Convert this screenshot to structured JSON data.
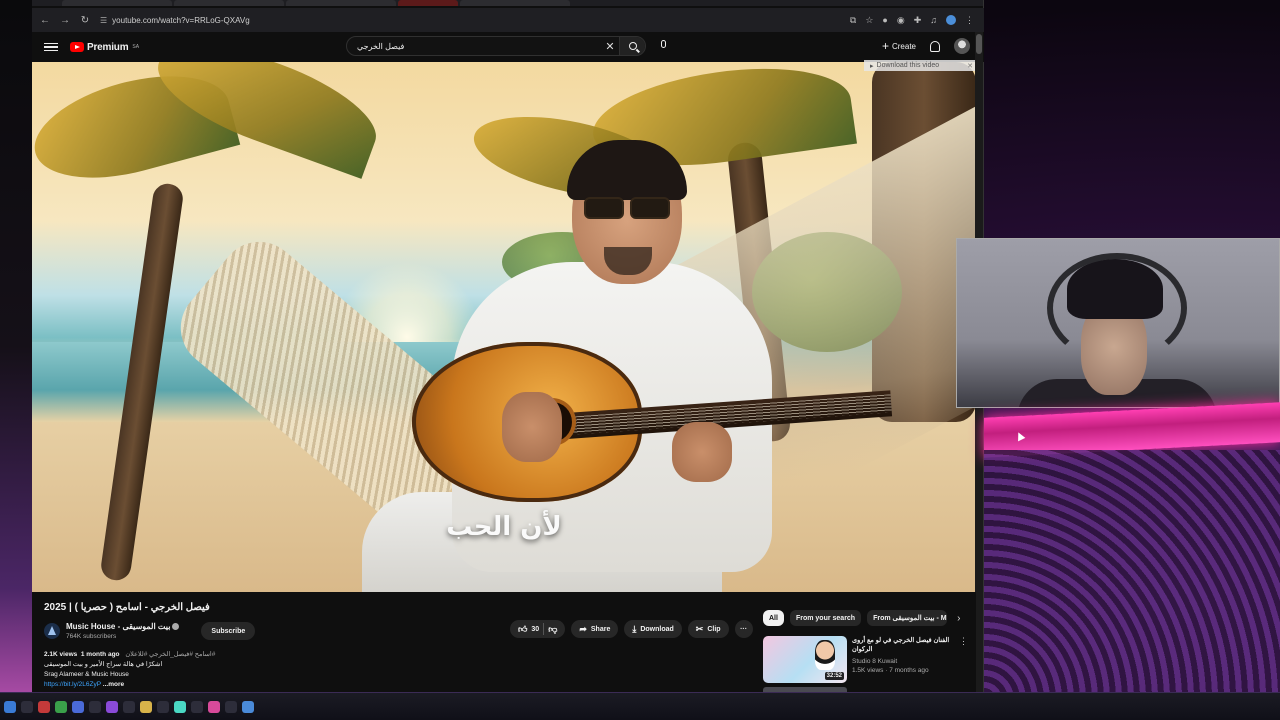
{
  "browser": {
    "url": "youtube.com/watch?v=RRLoG-QXAVg"
  },
  "masthead": {
    "logo_text": "Premium",
    "logo_sup": "SA",
    "search_query": "فيصل الخرجي",
    "create_label": "Create"
  },
  "video": {
    "caption": "لأن الحب",
    "download_bar": "Download this video"
  },
  "details": {
    "title": "فيصل الخرجي - اسامح ( حصريا ) | 2025",
    "channel_name": "Music House - بيت الموسيقى",
    "subscribers": "764K subscribers",
    "subscribe_label": "Subscribe",
    "likes": "30",
    "share_label": "Share",
    "download_label": "Download",
    "clip_label": "Clip",
    "more_actions": "···"
  },
  "description": {
    "views": "2.1K views",
    "age": "1 month ago",
    "hashtags": "#اسامح #فيصل_الخرجي #للاعلان",
    "line1": "اشكرًا في هالة سراج الأمير و بيت الموسيقى",
    "line2": "Srag Alameer & Music House",
    "link": "https://bit.ly/2L6ZyP",
    "more": "...more"
  },
  "recommendations": {
    "chips": [
      "All",
      "From your search",
      "From بيت الموسيقى - Music"
    ],
    "items": [
      {
        "title": "الفنان فيصل الخرجي في لو مع أروى الركوان",
        "channel": "Studio 8 Kuwait",
        "meta": "1.5K views · 7 months ago",
        "duration": "32:52"
      }
    ]
  },
  "colors": {
    "youtube_red": "#ff0000",
    "link_blue": "#3ea6ff",
    "overlay_pink": "#ff3fb2"
  }
}
